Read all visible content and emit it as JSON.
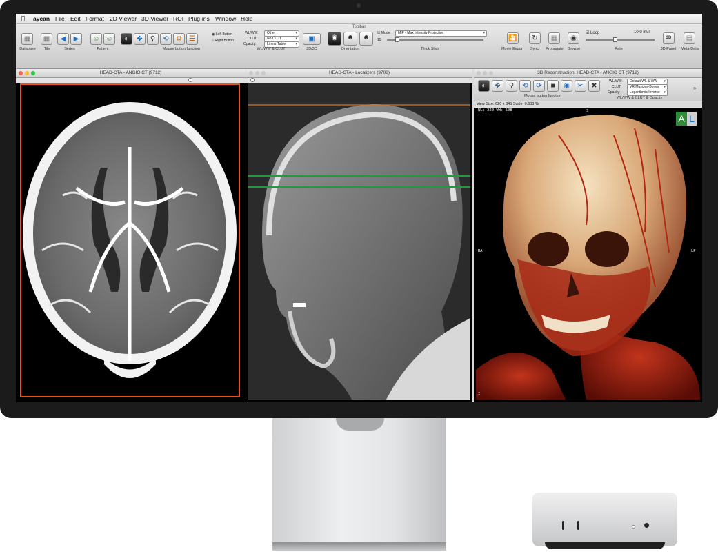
{
  "menubar": {
    "apple": "",
    "items": [
      "aycan",
      "File",
      "Edit",
      "Format",
      "2D Viewer",
      "3D Viewer",
      "ROI",
      "Plug-ins",
      "Window",
      "Help"
    ]
  },
  "toolbar": {
    "title": "Toolbar",
    "labels": {
      "database": "Database",
      "tile": "Tile",
      "series": "Series",
      "patient": "Patient",
      "mouse_button_function": "Mouse button function",
      "wlww_clut": "WL/WW & CLUT",
      "view_2d3d": "2D/3D",
      "orientation": "Orientation",
      "thick_slab": "Thick Slab",
      "movie_export": "Movie Export",
      "sync": "Sync",
      "propagate": "Propagate",
      "browse": "Browse",
      "rate": "Rate",
      "panel_3d": "3D Panel",
      "meta_data": "Meta-Data"
    },
    "mouse_buttons": {
      "left": "Left Button",
      "right": "Right Button"
    },
    "wlww": {
      "label": "WL/WW:",
      "value": "Other"
    },
    "clut": {
      "label": "CLUT:",
      "value": "No CLUT"
    },
    "opacity": {
      "label": "Opacity:",
      "value": "Linear Table"
    },
    "mode": {
      "label": "Mode:",
      "value": "MIP - Max Intensity Projection",
      "checked": true,
      "slab": "15"
    },
    "loop": {
      "label": "Loop",
      "checked": true
    },
    "rate_value": "10.0 im/s",
    "icon_3d": "3D"
  },
  "windows": {
    "axial": {
      "title": "HEAD-CTA - ANGIO CT (9712)"
    },
    "localizer": {
      "title": "HEAD-CTA - Localizers (9708)"
    },
    "recon": {
      "title": "3D Reconstruction: HEAD-CTA - ANGIO CT (9712)",
      "wlww": {
        "label": "WL/WW:",
        "value": "Default WL & WW"
      },
      "clut": {
        "label": "CLUT:",
        "value": "VR Muscles-Bones"
      },
      "opacity": {
        "label": "Opacity:",
        "value": "Logarithmic Inverse"
      },
      "mouse_button_function": "Mouse button function",
      "wlww_clut_opacity": "WL/WW & CLUT & Opacity",
      "view_size": "View Size: 620 x 845   Scale: 0.603 %",
      "wl_line": "WL: 220 WW: 508",
      "orient_top": "S",
      "orient_left": "RA",
      "orient_right": "LP",
      "orient_bottom": "I",
      "corner_a": "A",
      "corner_l": "L"
    }
  },
  "colors": {
    "accent": "#1c6fc4",
    "selected_border": "#e8541b",
    "localizer_top_line": "#d7781e",
    "localizer_green_line": "#1f9a3d",
    "close": "#fc5f57",
    "minimize": "#fdbc2e",
    "maximize": "#28c840"
  }
}
